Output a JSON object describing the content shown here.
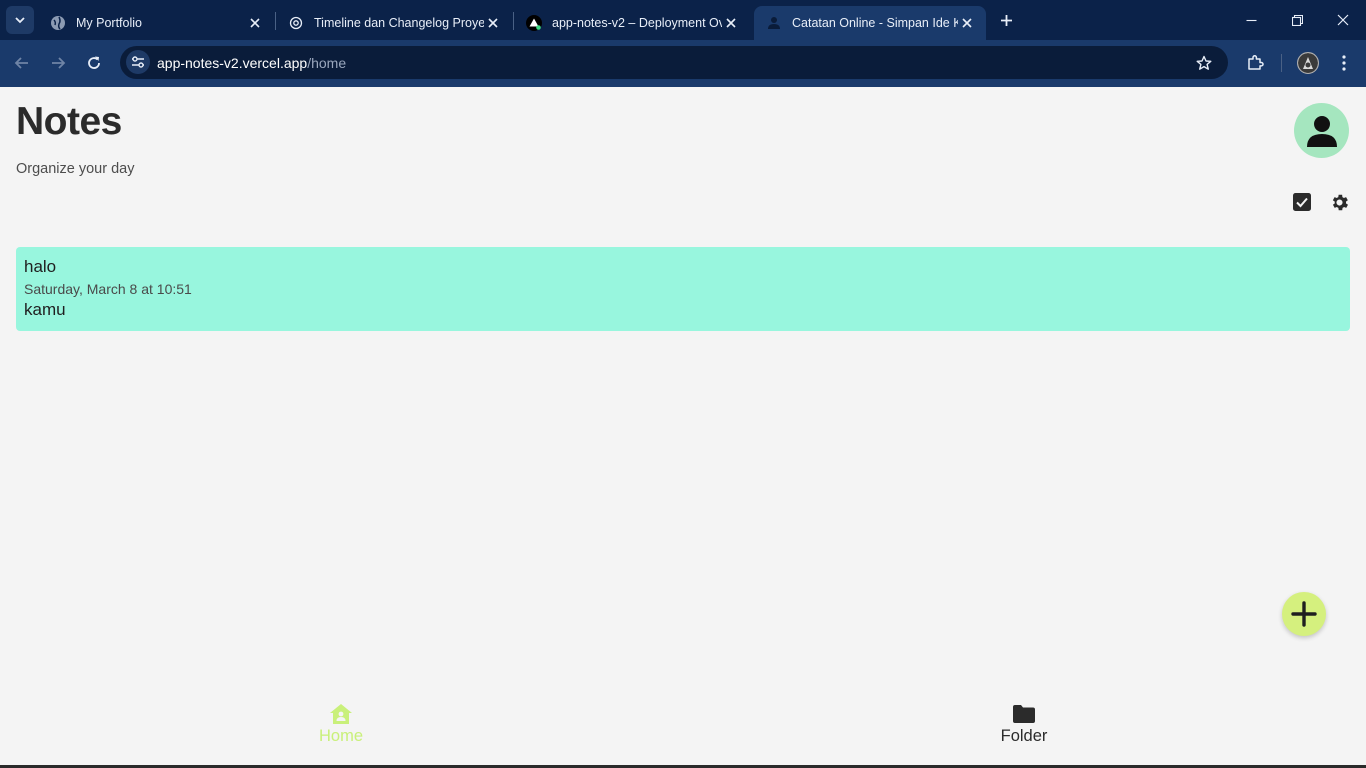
{
  "browser": {
    "tabs": [
      {
        "title": "My Portfolio",
        "favicon": "globe-icon",
        "active": false
      },
      {
        "title": "Timeline dan Changelog Proyek",
        "favicon": "openai-icon",
        "active": false
      },
      {
        "title": "app-notes-v2 – Deployment Ov",
        "favicon": "vercel-triangle-icon",
        "active": false
      },
      {
        "title": "Catatan Online - Simpan Ide Ka",
        "favicon": "person-icon",
        "active": true
      }
    ],
    "url_host": "app-notes-v2.vercel.app",
    "url_path": "/home"
  },
  "app": {
    "title": "Notes",
    "subtitle": "Organize your day",
    "notes": [
      {
        "title": "halo",
        "date": "Saturday, March 8 at 10:51",
        "body": "kamu",
        "color": "#98f6de"
      }
    ],
    "bottom_nav": [
      {
        "label": "Home",
        "icon": "home-icon",
        "active": true
      },
      {
        "label": "Folder",
        "icon": "folder-icon",
        "active": false
      }
    ],
    "colors": {
      "accent": "#c9f07a",
      "avatar_bg": "#a5e6bf",
      "fab_bg": "#d5f07e",
      "chrome_bg": "#0b2249"
    }
  }
}
